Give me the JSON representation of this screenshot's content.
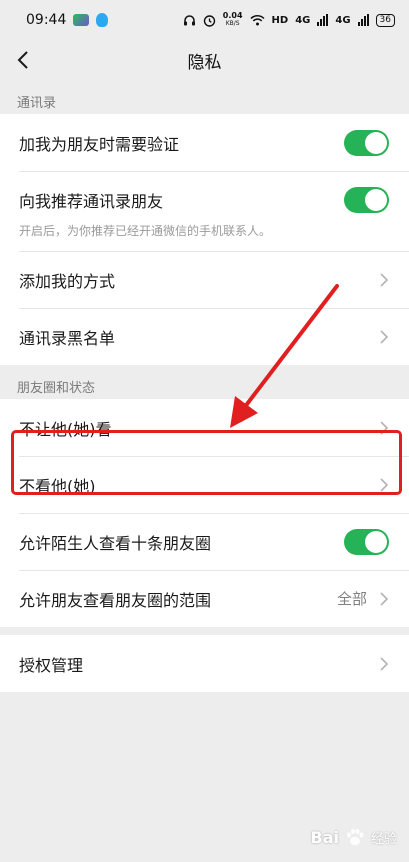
{
  "status_bar": {
    "time": "09:44",
    "net_speed_value": "0.04",
    "net_speed_unit": "KB/S",
    "hd_label": "HD",
    "net1_label": "4G",
    "net2_label": "4G",
    "battery": "36"
  },
  "nav": {
    "title": "隐私"
  },
  "sections": {
    "contacts": {
      "header": "通讯录",
      "verify_label": "加我为朋友时需要验证",
      "recommend_label": "向我推荐通讯录朋友",
      "recommend_desc": "开启后，为你推荐已经开通微信的手机联系人。",
      "add_methods_label": "添加我的方式",
      "blacklist_label": "通讯录黑名单"
    },
    "moments": {
      "header": "朋友圈和状态",
      "block_label": "不让他(她)看",
      "hide_label": "不看他(她)",
      "stranger_label": "允许陌生人查看十条朋友圈",
      "range_label": "允许朋友查看朋友圈的范围",
      "range_value": "全部"
    },
    "auth": {
      "manage_label": "授权管理"
    }
  },
  "toggles": {
    "verify_on": true,
    "recommend_on": true,
    "stranger_on": true
  },
  "watermark": {
    "brand": "Bai",
    "sub": "经验"
  },
  "colors": {
    "toggle_on": "#26b256",
    "annotation_red": "#e02020",
    "background": "#ededed"
  }
}
